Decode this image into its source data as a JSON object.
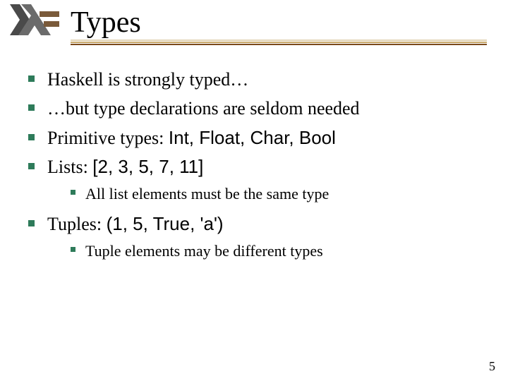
{
  "title": "Types",
  "bullets": {
    "b1": "Haskell is strongly typed…",
    "b2": "…but type declarations are seldom needed",
    "b3_pre": "Primitive types: ",
    "b3_code": "Int, Float, Char, Bool",
    "b4_pre": "Lists: ",
    "b4_code": "[2, 3, 5, 7, 11]",
    "b4_sub": "All list elements must be the same type",
    "b5_pre": "Tuples: ",
    "b5_code": "(1, 5, True, 'a')",
    "b5_sub": "Tuple elements may be different types"
  },
  "page_number": "5"
}
